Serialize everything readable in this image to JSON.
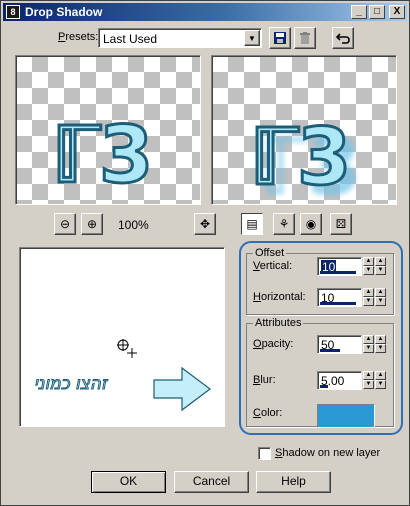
{
  "window": {
    "title": "Drop Shadow",
    "minimize": "_",
    "maximize": "□",
    "close": "X"
  },
  "presets": {
    "label": "Presets:",
    "value": "Last Used"
  },
  "preview": {
    "zoom": "100%",
    "glyph": "ℾ3"
  },
  "canvas": {
    "text": "זהצו כמוני"
  },
  "offset": {
    "group_label": "Offset",
    "vertical_label": "Vertical:",
    "vertical_value": "10",
    "horizontal_label": "Horizontal:",
    "horizontal_value": "10"
  },
  "attributes": {
    "group_label": "Attributes",
    "opacity_label": "Opacity:",
    "opacity_value": "50",
    "blur_label": "Blur:",
    "blur_value": "5.00",
    "color_label": "Color:",
    "color_hex": "#2b9ad3"
  },
  "shadow_new_layer": {
    "label": "Shadow on new layer",
    "checked": false
  },
  "buttons": {
    "ok": "OK",
    "cancel": "Cancel",
    "help": "Help"
  }
}
